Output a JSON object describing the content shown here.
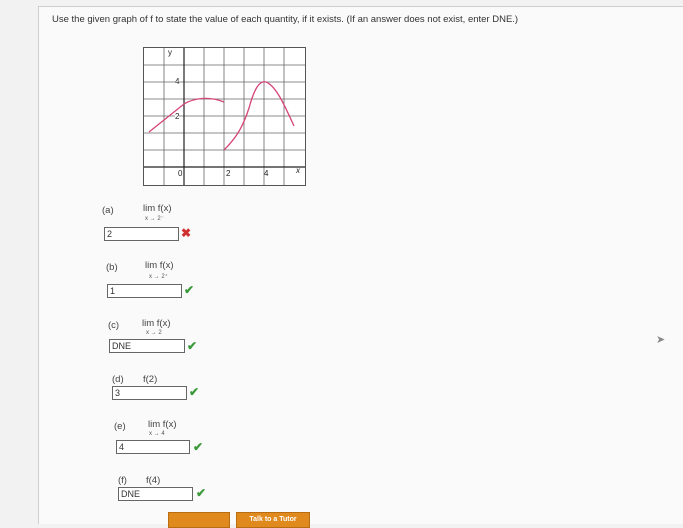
{
  "prompt": "Use the given graph of f to state the value of each quantity, if it exists. (If an answer does not exist, enter DNE.)",
  "graph": {
    "ticks": {
      "x0": "0",
      "x2": "2",
      "x4": "4",
      "y2": "2",
      "y4": "4"
    },
    "axis_labels": {
      "x": "x",
      "y": "y"
    },
    "curve_color": "#d6457a"
  },
  "parts": [
    {
      "label": "(a)",
      "expr": "lim  f(x)",
      "sub": "x → 2⁻",
      "answer": "2",
      "result": "incorrect"
    },
    {
      "label": "(b)",
      "expr": "lim  f(x)",
      "sub": "x → 2⁺",
      "answer": "1",
      "result": "correct"
    },
    {
      "label": "(c)",
      "expr": "lim  f(x)",
      "sub": "x → 2",
      "answer": "DNE",
      "result": "correct"
    },
    {
      "label": "(d)",
      "expr": "f(2)",
      "sub": "",
      "answer": "3",
      "result": "correct"
    },
    {
      "label": "(e)",
      "expr": "lim  f(x)",
      "sub": "x → 4",
      "answer": "4",
      "result": "correct"
    },
    {
      "label": "(f)",
      "expr": "f(4)",
      "sub": "",
      "answer": "DNE",
      "result": "correct"
    }
  ],
  "marks": {
    "correct": "✔",
    "incorrect": "✖"
  },
  "buttons": {
    "tutor": "Talk to a Tutor"
  }
}
